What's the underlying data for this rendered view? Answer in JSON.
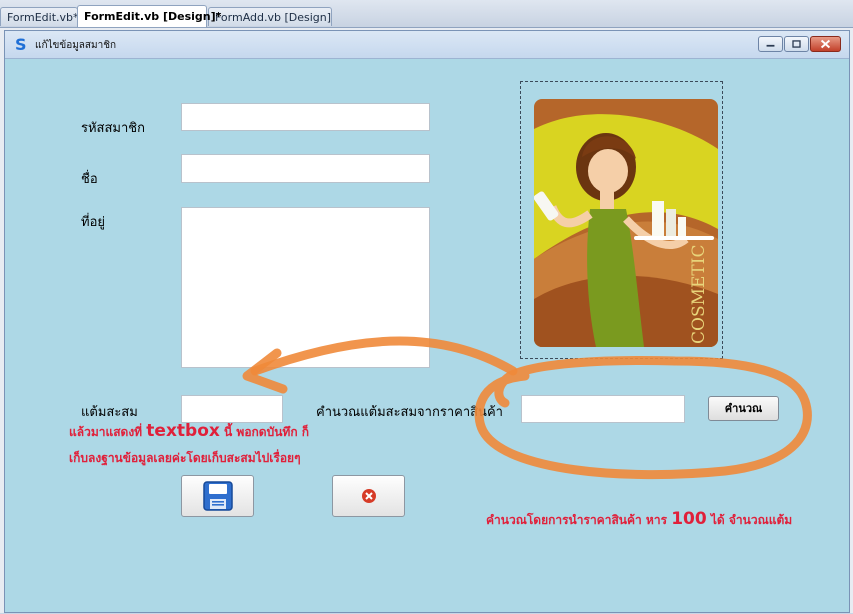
{
  "tabs": [
    {
      "label": "FormEdit.vb*"
    },
    {
      "label": "FormEdit.vb [Design]*"
    },
    {
      "label": "FormAdd.vb [Design]"
    }
  ],
  "window": {
    "title": "แก้ไขข้อมูลสมาชิก"
  },
  "form": {
    "member_id_label": "รหัสสมาชิก",
    "name_label": "ชื่อ",
    "address_label": "ที่อยู่",
    "points_label": "แต้มสะสม",
    "calc_label": "คำนวณแต้มสะสมจากราคาสินค้า",
    "calc_button": "คำนวณ",
    "member_id_value": "",
    "name_value": "",
    "address_value": "",
    "points_value": "",
    "price_value": ""
  },
  "picture": {
    "brand_text": "COSMETIC"
  },
  "annotations": {
    "note1_prefix": "แล้วมาแสดงที่",
    "note1_highlight": "textbox",
    "note1_suffix": "นี้ พอกดบันทึก ก็",
    "note2": "เก็บลงฐานข้อมูลเลยค่ะโดยเก็บสะสมไปเรื่อยๆ",
    "note3_prefix": "คำนวณโดยการนำราคาสินค้า หาร",
    "note3_number": "100",
    "note3_suffix": "ได้ จำนวณแต้ม"
  },
  "colors": {
    "form_background": "#add8e6",
    "annotation_text": "#e0203a",
    "annotation_stroke": "#f08a3a"
  },
  "icons": {
    "save": "floppy-disk-icon",
    "cancel": "close-circle-icon"
  }
}
